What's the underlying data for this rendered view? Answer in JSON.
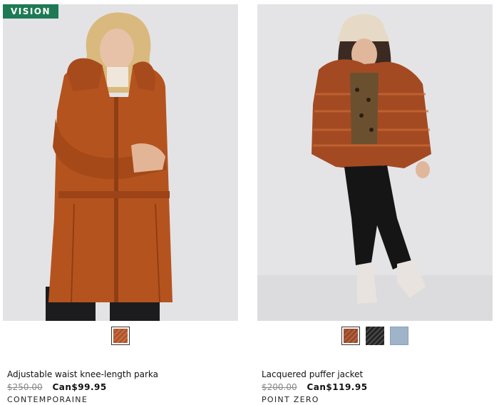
{
  "products": [
    {
      "badge": "VISION",
      "name": "Adjustable waist knee-length parka",
      "old_price": "$250.00",
      "new_price": "Can$99.95",
      "brand": "CONTEMPORAINE",
      "selected_color": "#b35325",
      "swatches": [
        {
          "name": "burnt orange",
          "color": "#b35325",
          "selected": true
        }
      ]
    },
    {
      "name": "Lacquered puffer jacket",
      "old_price": "$200.00",
      "new_price": "Can$119.95",
      "brand": "POINT ZERO",
      "selected_color": "#9c4725",
      "swatches": [
        {
          "name": "rust",
          "color": "#9c4725",
          "selected": true
        },
        {
          "name": "black",
          "color": "#232323",
          "selected": false
        },
        {
          "name": "light blue",
          "color": "#9fb4c8",
          "selected": false
        }
      ]
    }
  ],
  "colors": {
    "badge_bg": "#1e7a55",
    "photo_bg": "#e4e4e6"
  }
}
